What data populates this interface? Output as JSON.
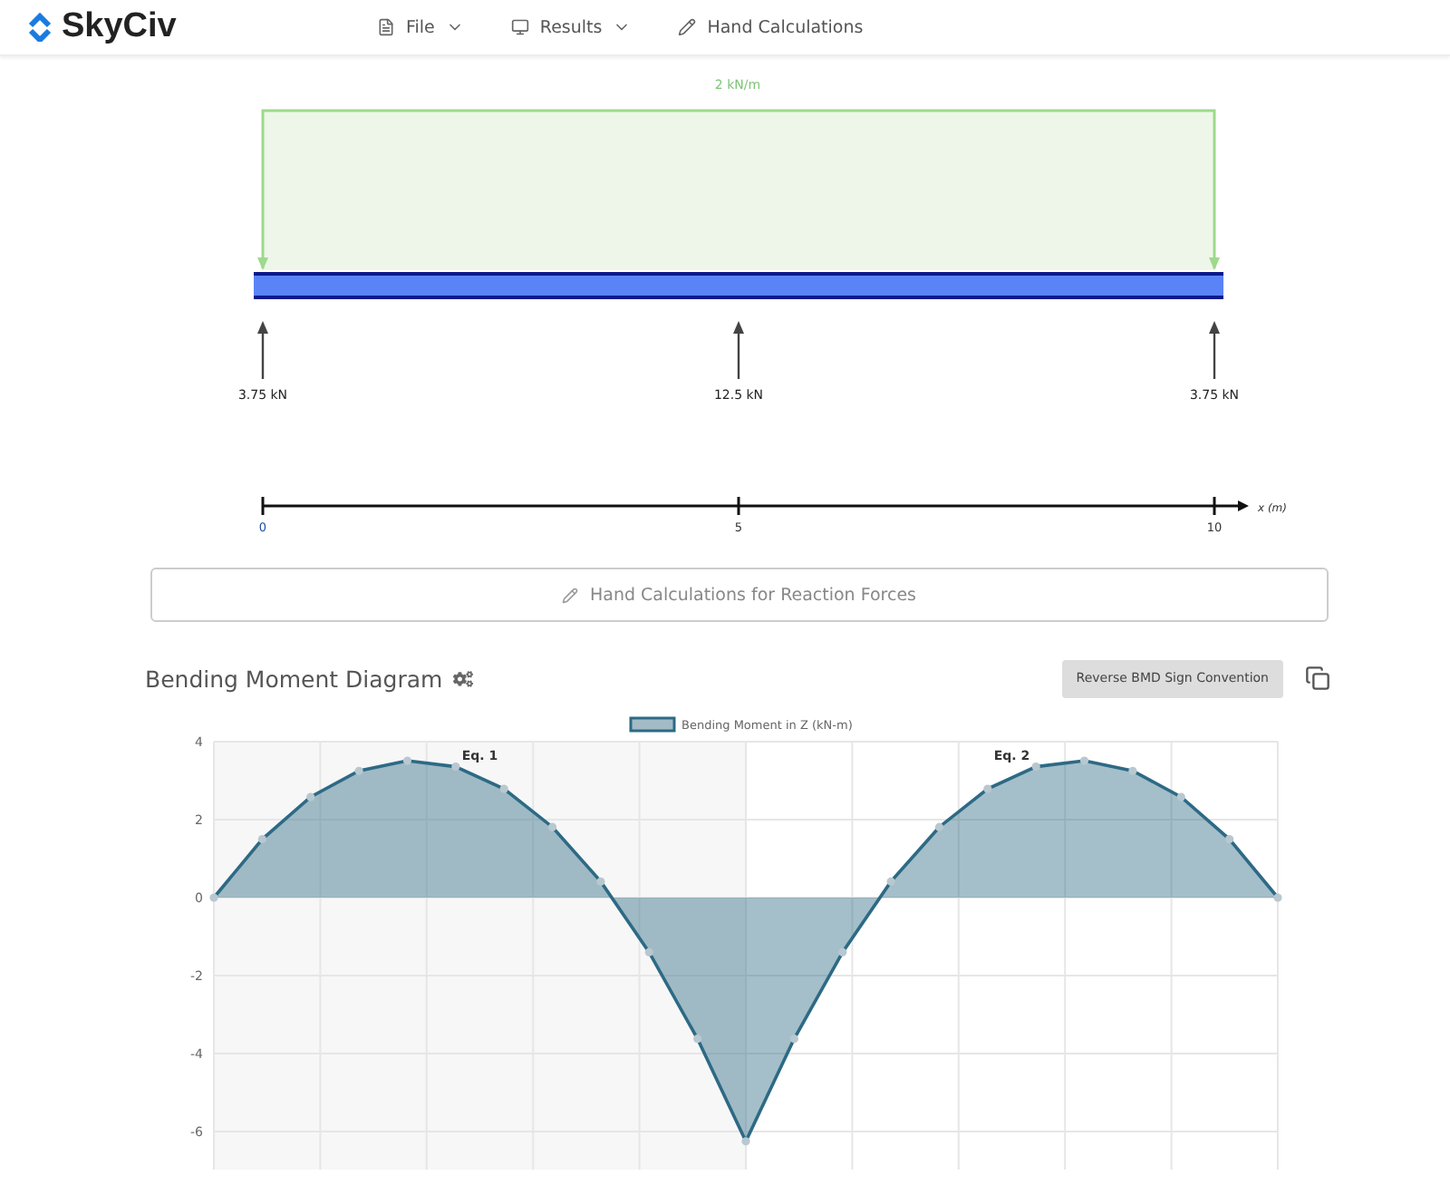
{
  "header": {
    "logo": "SkyCiv",
    "menu": [
      {
        "label": "File",
        "dropdown": true
      },
      {
        "label": "Results",
        "dropdown": true
      },
      {
        "label": "Hand Calculations",
        "dropdown": false
      }
    ]
  },
  "beam_diagram": {
    "load_label": "2 kN/m",
    "reactions": [
      "3.75 kN",
      "12.5 kN",
      "3.75 kN"
    ],
    "axis_ticks": [
      "0",
      "5",
      "10"
    ],
    "axis_label": "x (m)"
  },
  "hand_calc_button": "Hand Calculations for Reaction Forces",
  "bmd": {
    "title": "Bending Moment Diagram",
    "reverse_button": "Reverse BMD Sign Convention",
    "chart_data": {
      "type": "area",
      "grid": true,
      "ylim": [
        -7,
        4
      ],
      "yticks": [
        4,
        2,
        0,
        -2,
        -4,
        -6
      ],
      "categories": [
        null,
        null,
        null,
        null,
        null,
        null,
        null,
        null,
        null,
        null,
        null,
        null,
        null,
        null,
        null,
        null,
        null,
        null,
        null,
        null,
        null,
        null,
        null
      ],
      "series": [
        {
          "name": "Bending Moment in Z (kN-m)",
          "color": "#2d6a85",
          "values": [
            0,
            1.5,
            2.58,
            3.25,
            3.51,
            3.36,
            2.79,
            1.81,
            0.41,
            -1.4,
            -3.62,
            -6.25,
            -3.62,
            -1.4,
            0.41,
            1.81,
            2.79,
            3.36,
            3.51,
            3.25,
            2.58,
            1.5,
            0
          ]
        }
      ],
      "annotations": [
        "Eq. 1",
        "Eq. 2"
      ]
    }
  }
}
